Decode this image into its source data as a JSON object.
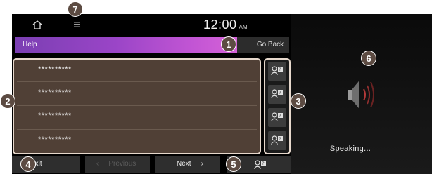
{
  "status_bar": {
    "time": "12:00",
    "ampm": "AM"
  },
  "help_bar": {
    "title": "Help",
    "go_back_label": "Go Back"
  },
  "commands": [
    {
      "text": "**********"
    },
    {
      "text": "**********"
    },
    {
      "text": "**********"
    },
    {
      "text": "**********"
    }
  ],
  "bottom_bar": {
    "exit_label": "Exit",
    "previous_label": "Previous",
    "previous_arrow": "‹",
    "next_label": "Next",
    "next_arrow": "›"
  },
  "voice_panel": {
    "status": "Speaking..."
  },
  "callouts": [
    "1",
    "2",
    "3",
    "4",
    "5",
    "6",
    "7"
  ],
  "colors": {
    "accent_gradient_start": "#7b3fb3",
    "accent_gradient_end": "#d562d8",
    "list_background": "#504036",
    "highlight_border": "#e6d8cc",
    "callout": "#5c4b42"
  },
  "icons": [
    "home-icon",
    "menu-icon",
    "voice-speaker-icon",
    "speaker-sound-icon"
  ]
}
